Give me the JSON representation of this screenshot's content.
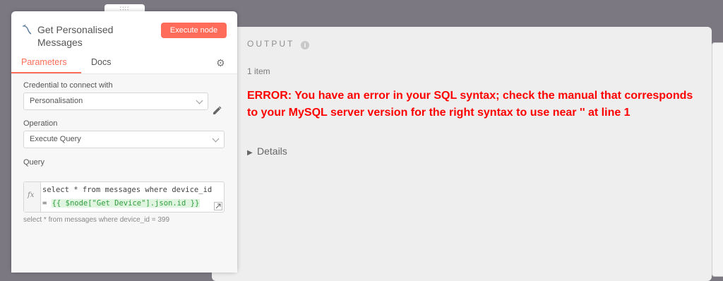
{
  "node": {
    "title": "Get Personalised Messages",
    "execute_label": "Execute node",
    "tabs": [
      {
        "label": "Parameters"
      },
      {
        "label": "Docs"
      }
    ],
    "params": {
      "credential_label": "Credential to connect with",
      "credential_value": "Personalisation",
      "operation_label": "Operation",
      "operation_value": "Execute Query",
      "query_label": "Query",
      "query_line1": "select * from messages where device_id",
      "query_line2_prefix": "= ",
      "query_expression": "{{ $node[\"Get Device\"].json.id }}",
      "query_preview": "select * from messages where device_id = 399"
    }
  },
  "output": {
    "heading": "OUTPUT",
    "item_count": "1 item",
    "error": "ERROR: You have an error in your SQL syntax; check the manual that corresponds to your MySQL server version for the right syntax to use near '' at line 1",
    "details_label": "Details"
  },
  "icons": {
    "node": "mysql-icon",
    "settings": "gear-icon",
    "info": "info-icon",
    "edit": "pencil-icon",
    "expand": "expand-icon",
    "details": "chevron-right-icon"
  },
  "colors": {
    "accent": "#ff6d5a",
    "error": "#ff0000",
    "expression_bg": "#e0f5e0",
    "expression_text": "#2f9e3f"
  }
}
